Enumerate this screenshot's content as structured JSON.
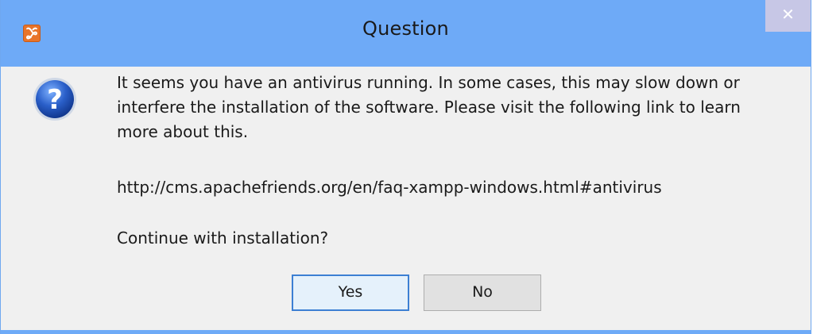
{
  "window": {
    "title": "Question",
    "close_glyph": "✕",
    "titlebar_color": "#6eaaf7",
    "app_icon": "xampp-icon"
  },
  "dialog": {
    "icon": "question-icon",
    "message": "It seems you have an antivirus running. In some cases, this may slow down or interfere the installation of the software. Please visit the following link to learn more about this.",
    "link": "http://cms.apachefriends.org/en/faq-xampp-windows.html#antivirus",
    "prompt": "Continue with installation?"
  },
  "buttons": {
    "yes_label": "Yes",
    "no_label": "No",
    "default_border_color": "#3c7fd3"
  }
}
